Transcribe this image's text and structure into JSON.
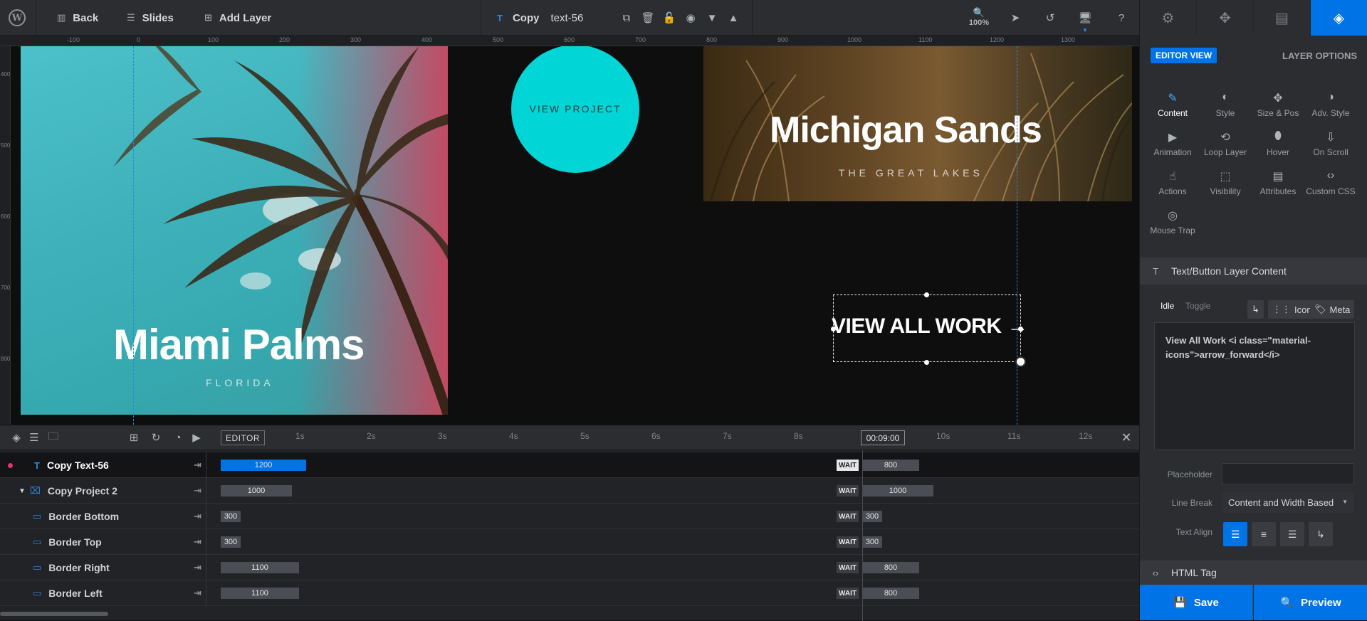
{
  "topbar": {
    "back_label": "Back",
    "slides_label": "Slides",
    "add_layer_label": "Add Layer",
    "layer_prefix": "Copy",
    "layer_name": "text-56",
    "zoom": "100%"
  },
  "ruler": {
    "top_ticks": [
      "-100",
      "0",
      "100",
      "200",
      "300",
      "400",
      "500",
      "600",
      "700",
      "800",
      "900",
      "1000",
      "1100",
      "1200",
      "1300"
    ],
    "left_ticks": [
      "400",
      "500",
      "600",
      "700",
      "800"
    ]
  },
  "canvas": {
    "circle_label": "VIEW PROJECT",
    "card1_title": "Miami Palms",
    "card1_subtitle": "FLORIDA",
    "card2_title": "Michigan Sands",
    "card2_subtitle": "THE GREAT LAKES",
    "button_label": "VIEW ALL WORK",
    "button_arrow": "→"
  },
  "timeline": {
    "editor_label": "EDITOR",
    "current_time": "00:09:00",
    "ticks": [
      "1s",
      "2s",
      "3s",
      "4s",
      "5s",
      "6s",
      "7s",
      "8s",
      "10s",
      "11s",
      "12s"
    ],
    "rows": [
      {
        "name": "Copy Text-56",
        "start": "1200",
        "wait": "WAIT",
        "end": "800",
        "selected": true
      },
      {
        "name": "Copy Project 2",
        "start": "1000",
        "wait": "WAIT",
        "end": "1000"
      },
      {
        "name": "Border Bottom",
        "start": "300",
        "wait": "WAIT",
        "end": "300"
      },
      {
        "name": "Border Top",
        "start": "300",
        "wait": "WAIT",
        "end": "300"
      },
      {
        "name": "Border Right",
        "start": "1100",
        "wait": "WAIT",
        "end": "800"
      },
      {
        "name": "Border Left",
        "start": "1100",
        "wait": "WAIT",
        "end": "800"
      }
    ]
  },
  "panel": {
    "editor_view": "EDITOR VIEW",
    "layer_options": "LAYER OPTIONS",
    "options": [
      {
        "label": "Content",
        "icon": "pencil-icon"
      },
      {
        "label": "Style",
        "icon": "palette-icon"
      },
      {
        "label": "Size & Pos",
        "icon": "move-icon"
      },
      {
        "label": "Adv. Style",
        "icon": "contrast-icon"
      },
      {
        "label": "Animation",
        "icon": "play-icon"
      },
      {
        "label": "Loop Layer",
        "icon": "loop-icon"
      },
      {
        "label": "Hover",
        "icon": "mouse-icon"
      },
      {
        "label": "On Scroll",
        "icon": "scroll-icon"
      },
      {
        "label": "Actions",
        "icon": "hand-icon"
      },
      {
        "label": "Visibility",
        "icon": "visibility-icon"
      },
      {
        "label": "Attributes",
        "icon": "file-icon"
      },
      {
        "label": "Custom CSS",
        "icon": "code-icon"
      },
      {
        "label": "Mouse Trap",
        "icon": "target-icon"
      }
    ],
    "section_title": "Text/Button Layer Content",
    "tab_idle": "Idle",
    "tab_toggle": "Toggle",
    "icon_label": "Icon",
    "meta_label": "Meta",
    "content_text": "View All Work  <i class=\"material-icons\">arrow_forward</i>",
    "placeholder_label": "Placeholder",
    "placeholder_value": "",
    "line_break_label": "Line Break",
    "line_break_value": "Content and Width Based",
    "text_align_label": "Text Align",
    "html_tag_label": "HTML Tag",
    "save_label": "Save",
    "preview_label": "Preview"
  },
  "colors": {
    "accent": "#0073e6",
    "circle": "#02d5d6",
    "guide": "#2e86de"
  }
}
